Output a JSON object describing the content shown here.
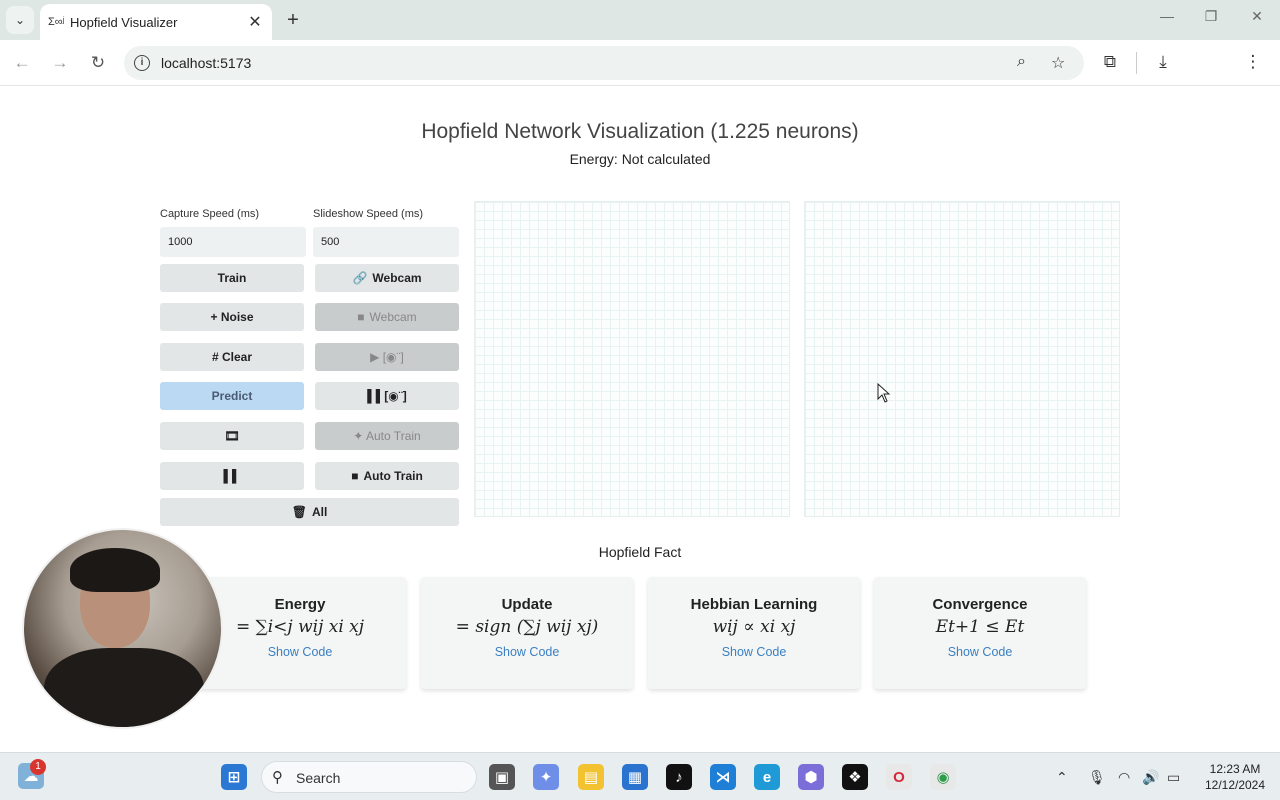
{
  "browser": {
    "tab_title": "Hopfield Visualizer",
    "tab_favicon": "Σ∞ʲ",
    "url": "localhost:5173",
    "new_tab": "+",
    "close_tab": "✕"
  },
  "page": {
    "title": "Hopfield Network Visualization (1.225 neurons)",
    "energy": "Energy: Not calculated"
  },
  "controls": {
    "capture_label": "Capture Speed (ms)",
    "capture_value": "1000",
    "slideshow_label": "Slideshow Speed (ms)",
    "slideshow_value": "500",
    "train": "Train",
    "webcam_start_icon": "🔗",
    "webcam_start": "Webcam",
    "noise": "+ Noise",
    "webcam_stop_icon": "■",
    "webcam_stop": "Webcam",
    "clear": "# Clear",
    "play_slideshow": "▶ [◉¨]",
    "predict": "Predict",
    "pause_slideshow": "▌▌[◉¨]",
    "film_icon": "🎞",
    "auto_train_start": "✦ Auto Train",
    "pause_icon": "▌▌",
    "auto_train_stop_icon": "■",
    "auto_train_stop": "Auto Train",
    "clear_all_icon": "🗑",
    "clear_all": "All"
  },
  "facts": {
    "title": "Hopfield Fact",
    "cards": [
      {
        "title": "Energy",
        "formula": "= ∑i<j wij xi xj",
        "link": "Show Code"
      },
      {
        "title": "Update",
        "formula": "= sign (∑j wij xj)",
        "link": "Show Code"
      },
      {
        "title": "Hebbian Learning",
        "formula": "wij ∝ xi xj",
        "link": "Show Code"
      },
      {
        "title": "Convergence",
        "formula": "Et+1 ≤ Et",
        "link": "Show Code"
      }
    ]
  },
  "taskbar": {
    "search_placeholder": "Search",
    "weather_badge": "1",
    "time": "12:23 AM",
    "date": "12/12/2024"
  },
  "colors": {
    "predict_bg": "#bcd9f3",
    "link": "#3a7fc1",
    "button_bg": "#e3e6e6",
    "disabled_bg": "#c9cccc"
  }
}
